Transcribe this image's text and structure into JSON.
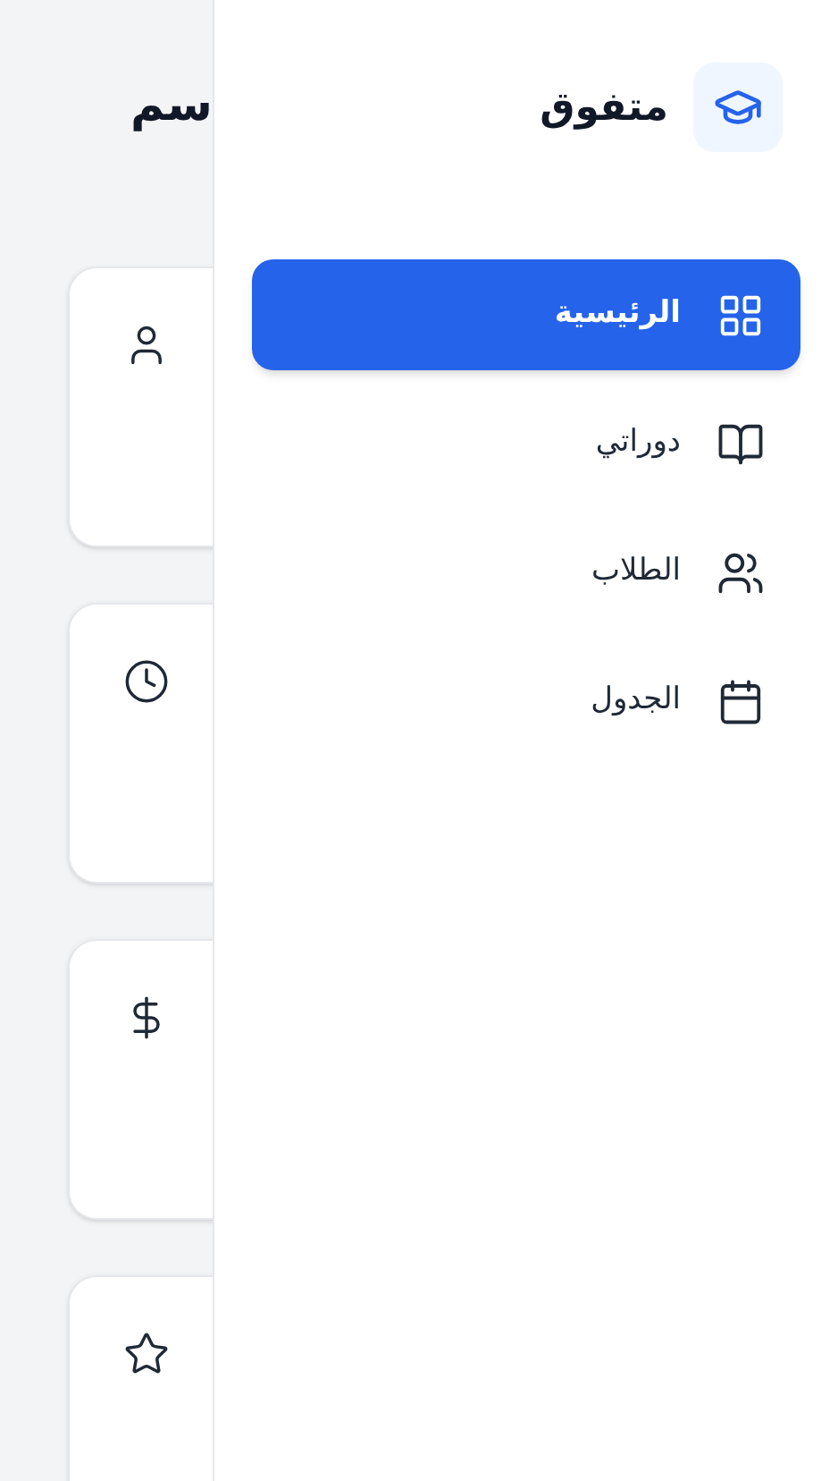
{
  "main": {
    "heading": "سم"
  },
  "sidebar": {
    "brand": "متفوق",
    "items": [
      {
        "label": "الرئيسية",
        "selected": true
      },
      {
        "label": "دوراتي",
        "selected": false
      },
      {
        "label": "الطلاب",
        "selected": false
      },
      {
        "label": "الجدول",
        "selected": false
      }
    ]
  }
}
